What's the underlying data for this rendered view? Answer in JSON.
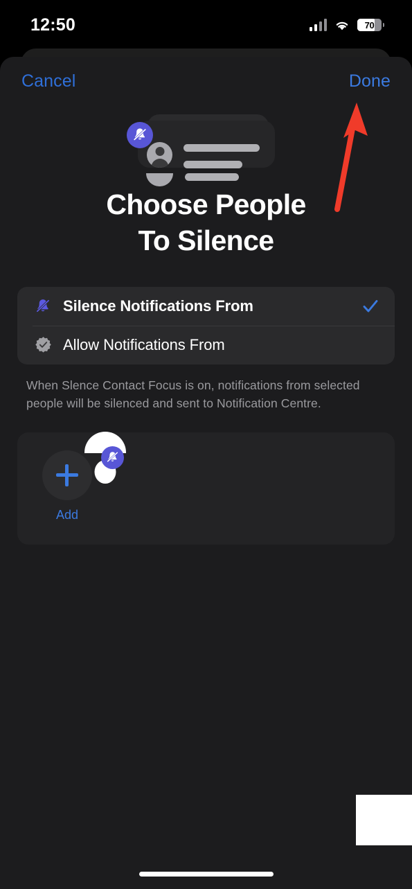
{
  "status_bar": {
    "time": "12:50",
    "battery_percent": "70",
    "battery_level": 70,
    "signal_icon": "cellular-signal-icon",
    "wifi_icon": "wifi-icon",
    "battery_icon": "battery-icon"
  },
  "nav": {
    "cancel_label": "Cancel",
    "done_label": "Done"
  },
  "hero": {
    "illustration_name": "silenced-notification-illustration",
    "badge_icon": "bell-slash-icon"
  },
  "title": "Choose People To Silence",
  "title_line1": "Choose People",
  "title_line2": "To Silence",
  "options": [
    {
      "label": "Silence Notifications From",
      "icon": "bell-slash-icon",
      "selected": true,
      "check_icon": "checkmark-icon"
    },
    {
      "label": "Allow Notifications From",
      "icon": "checkmark-seal-icon",
      "selected": false,
      "check_icon": ""
    }
  ],
  "footnote": "When Slence Contact Focus is on, notifications from selected people will be silenced and sent to Notification Centre.",
  "people": {
    "add_label": "Add",
    "add_icon": "plus-icon",
    "contacts": [
      {
        "avatar_icon": "person-avatar-icon",
        "badge_icon": "bell-slash-icon",
        "name": ""
      }
    ]
  },
  "annotation": {
    "arrow_name": "red-arrow-pointing-to-done",
    "arrow_color": "#F03B2A"
  },
  "colors": {
    "accent_blue": "#3b7ae0",
    "purple_badge": "#5856d6",
    "sheet_bg": "#1c1c1e",
    "card_bg": "#2a2a2c",
    "people_card_bg": "#232325",
    "footnote_text": "#9a9a9e",
    "annotation_red": "#F03B2A"
  }
}
